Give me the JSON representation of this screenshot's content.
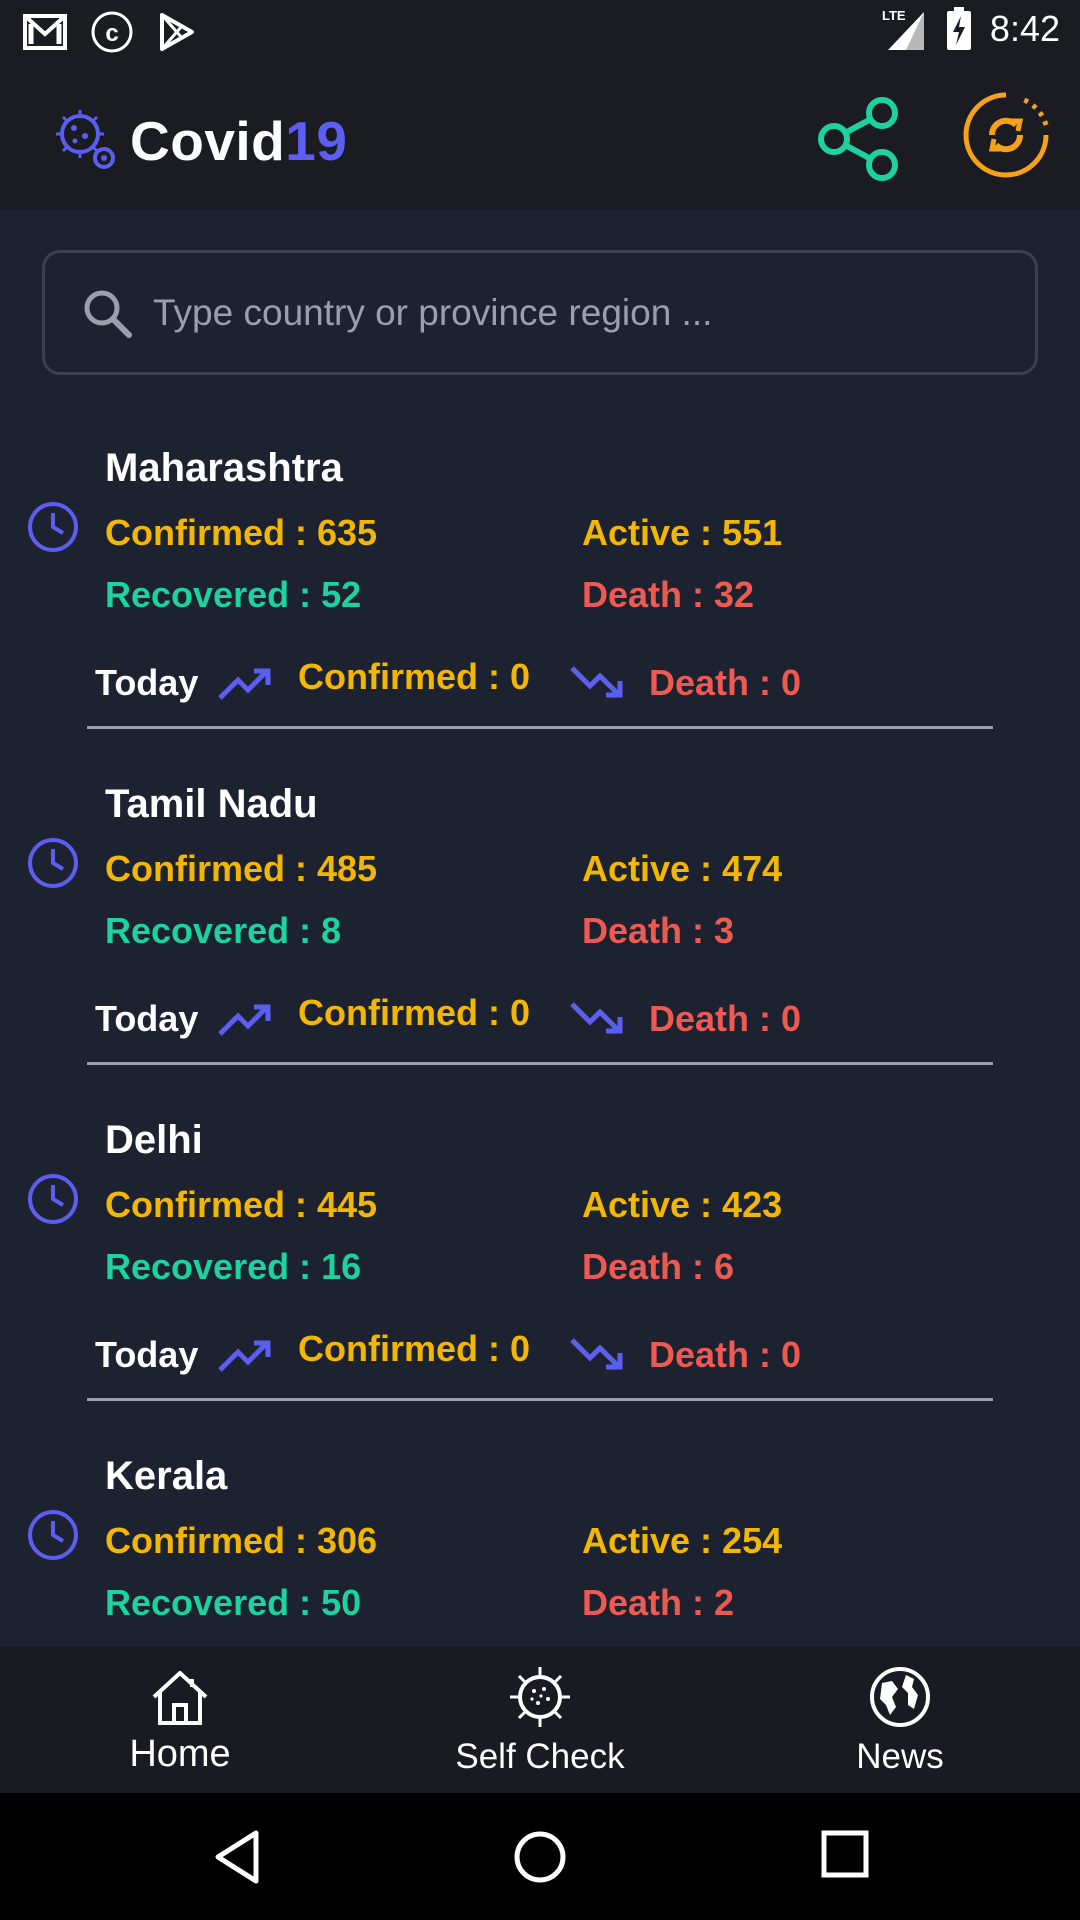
{
  "status_bar": {
    "time": "8:42",
    "network": "LTE"
  },
  "app": {
    "title_main": "Covid",
    "title_num": "19"
  },
  "search": {
    "placeholder": "Type country or province region ..."
  },
  "regions": [
    {
      "name": "Maharashtra",
      "confirmed": "Confirmed : 635",
      "active": "Active : 551",
      "recovered": "Recovered : 52",
      "death": "Death : 32",
      "today_label": "Today",
      "today_confirmed": "Confirmed : 0",
      "today_death": "Death : 0"
    },
    {
      "name": "Tamil Nadu",
      "confirmed": "Confirmed : 485",
      "active": "Active : 474",
      "recovered": "Recovered : 8",
      "death": "Death : 3",
      "today_label": "Today",
      "today_confirmed": "Confirmed : 0",
      "today_death": "Death : 0"
    },
    {
      "name": "Delhi",
      "confirmed": "Confirmed : 445",
      "active": "Active : 423",
      "recovered": "Recovered : 16",
      "death": "Death : 6",
      "today_label": "Today",
      "today_confirmed": "Confirmed : 0",
      "today_death": "Death : 0"
    },
    {
      "name": "Kerala",
      "confirmed": "Confirmed : 306",
      "active": "Active : 254",
      "recovered": "Recovered : 50",
      "death": "Death : 2"
    }
  ],
  "bottom_nav": {
    "home": "Home",
    "self_check": "Self Check",
    "news": "News"
  },
  "colors": {
    "accent": "#5b5ef0",
    "confirmed": "#f2b705",
    "recovered": "#1dd1a1",
    "death": "#ee5a52",
    "share": "#1dd1a1",
    "refresh": "#f5a11a"
  }
}
